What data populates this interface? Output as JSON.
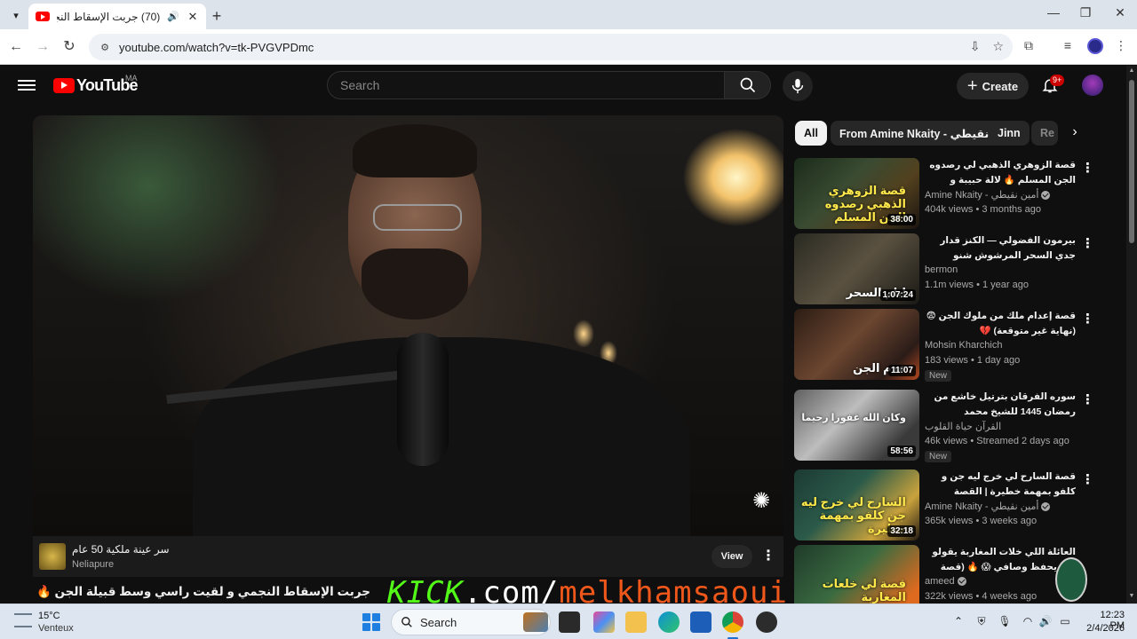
{
  "browser": {
    "tab_title": "(70) جربت الإسقاط النجمي و",
    "url": "youtube.com/watch?v=tk-PVGVPDmc"
  },
  "youtube": {
    "logo_text": "YouTube",
    "country_code": "MA",
    "search_placeholder": "Search",
    "create_label": "Create",
    "notification_count": "9+"
  },
  "player": {
    "ad": {
      "title": "سر عينة ملكية 50 عام",
      "advertiser": "Neliapure",
      "button_label": "View"
    },
    "video_title": "جربت الإسقاط النجمي و لقيت راسي وسط قبيلة الجن 🔥 | قصة حمزة",
    "overlay": {
      "part1": "KICK",
      "part2": ".com/",
      "part3": "melkhamsaoui"
    }
  },
  "chips": [
    {
      "label": "All",
      "active": true
    },
    {
      "label": "From Amine Nkaity - أمين نقيطي",
      "active": false
    },
    {
      "label": "Jinn",
      "active": false
    },
    {
      "label": "Re",
      "active": false
    }
  ],
  "recommendations": [
    {
      "title": "قصة الزوهري الذهبي لي رصدوه الجن المسلم 🔥 لالة حبيبة و مولاي بوعزة",
      "channel": "Amine Nkaity - أمين نقيطي",
      "verified": true,
      "meta": "404k views • 3 months ago",
      "duration": "38:00",
      "thumb_text": "قصة الزوهري الذهبي رصدوه الجن المسلم",
      "is_new": false
    },
    {
      "title": "بيرمون الفضولي — الكنز قدار جدي السحر المرشوش شنو علاقتو بكتاب السحر...",
      "channel": "bermon",
      "verified": false,
      "meta": "1.1m views • 1 year ago",
      "duration": "1:07:24",
      "thumb_text": "ايام السحر",
      "is_new": false
    },
    {
      "title": "قصة إعدام ملك من ملوك الجن 😨 (نهاية غير متوقعة) 💔",
      "channel": "Mohsin Kharchich",
      "verified": false,
      "meta": "183 views • 1 day ago",
      "duration": "11:07",
      "thumb_text": "عدم الجن",
      "is_new": true,
      "new_label": "New"
    },
    {
      "title": "سوره الفرقان بترتيل خاشع من رمضان 1445 للشيخ محمد اللحيدان",
      "channel": "القرآن حياة القلوب",
      "verified": false,
      "meta": "46k views • Streamed 2 days ago",
      "duration": "58:56",
      "thumb_text": "وكان الله غفورا رحيما",
      "is_new": true,
      "new_label": "New"
    },
    {
      "title": "قصة السارح لي خرج ليه جن و كلفو بمهمة خطيرة | القصة وقعات في دوار مغربي MA",
      "channel": "Amine Nkaity - أمين نقيطي",
      "verified": true,
      "meta": "365k views • 3 weeks ago",
      "duration": "32:18",
      "thumb_text": "السارح لي خرج ليه جن كلفو بمهمة خطيرة",
      "is_new": false
    },
    {
      "title": "العائلة اللي خلات المغاربة يقولو الله يحفظ وصافي 😱 🔥 (قصة خفت نعاودها)",
      "channel": "ameed",
      "verified": true,
      "meta": "322k views • 4 weeks ago",
      "duration": "",
      "thumb_text": "قصة لي خلعات المغاربة",
      "is_new": false
    }
  ],
  "taskbar": {
    "temperature": "15°C",
    "weather": "Venteux",
    "search_label": "Search",
    "time": "12:23 PM",
    "date": "2/4/2026"
  },
  "colors": {
    "yt_red": "#ff0000",
    "kick_green": "#53fc18",
    "overlay_orange": "#f0571a",
    "accent_blue": "#1f7fe0"
  }
}
